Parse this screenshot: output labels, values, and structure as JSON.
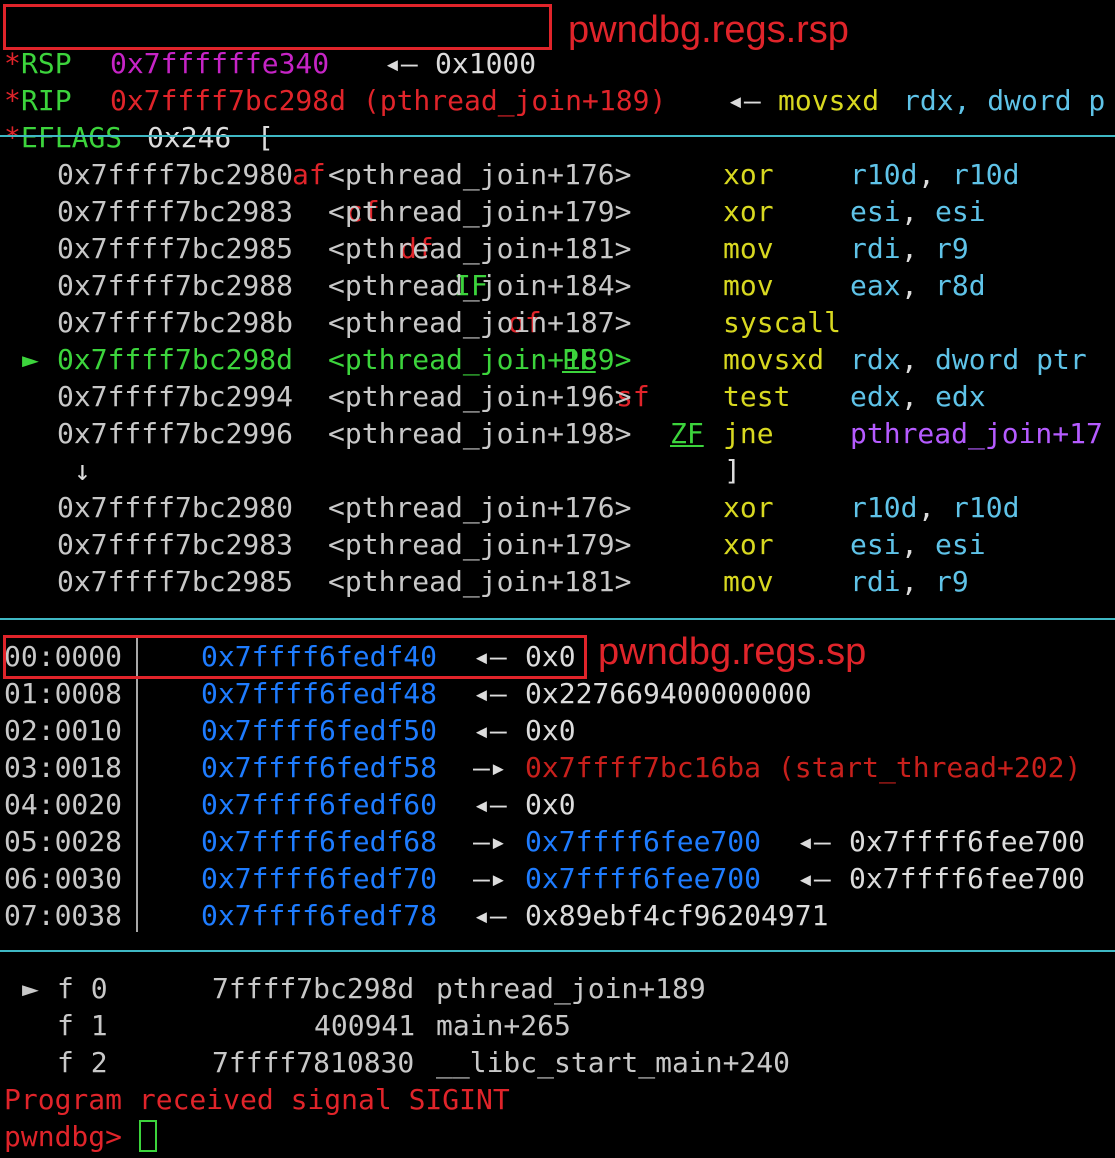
{
  "registers": {
    "rsp": {
      "star": "*",
      "name": "RSP",
      "value": "0x7ffffffe340",
      "arrow": "◂—",
      "points_to": "0x1000"
    },
    "rip": {
      "star": "*",
      "name": "RIP",
      "value": "0x7ffff7bc298d (pthread_join+189)",
      "arrow": "◂—",
      "insn": "movsxd",
      "operands": "rdx, dword p"
    },
    "eflags": {
      "star": "*",
      "name": "EFLAGS",
      "value": "0x246",
      "open": "[",
      "close": "]",
      "flags": [
        {
          "name": "af",
          "set": false
        },
        {
          "name": "cf",
          "set": false
        },
        {
          "name": "df",
          "set": false
        },
        {
          "name": "IF",
          "set": true
        },
        {
          "name": "of",
          "set": false
        },
        {
          "name": "PF",
          "set": true
        },
        {
          "name": "sf",
          "set": false
        },
        {
          "name": "ZF",
          "set": true
        }
      ]
    }
  },
  "disasm": {
    "current_marker": "►",
    "jump_arrow": "↓",
    "lines": [
      {
        "addr": "0x7ffff7bc2980",
        "sym": "<pthread_join+176>",
        "mnem": "xor",
        "op1": "r10d",
        "sep": ",",
        "op2": "r10d"
      },
      {
        "addr": "0x7ffff7bc2983",
        "sym": "<pthread_join+179>",
        "mnem": "xor",
        "op1": "esi",
        "sep": ",",
        "op2": "esi"
      },
      {
        "addr": "0x7ffff7bc2985",
        "sym": "<pthread_join+181>",
        "mnem": "mov",
        "op1": "rdi",
        "sep": ",",
        "op2": "r9"
      },
      {
        "addr": "0x7ffff7bc2988",
        "sym": "<pthread_join+184>",
        "mnem": "mov",
        "op1": "eax",
        "sep": ",",
        "op2": "r8d"
      },
      {
        "addr": "0x7ffff7bc298b",
        "sym": "<pthread_join+187>",
        "mnem": "syscall",
        "op1": "",
        "sep": "",
        "op2": ""
      },
      {
        "addr": "0x7ffff7bc298d",
        "sym": "<pthread_join+189>",
        "mnem": "movsxd",
        "op1": "rdx",
        "sep": ",",
        "op2": "dword ptr"
      },
      {
        "addr": "0x7ffff7bc2994",
        "sym": "<pthread_join+196>",
        "mnem": "test",
        "op1": "edx",
        "sep": ",",
        "op2": "edx"
      },
      {
        "addr": "0x7ffff7bc2996",
        "sym": "<pthread_join+198>",
        "mnem": "jne",
        "op1": "pthread_join+17",
        "sep": "",
        "op2": ""
      },
      {
        "addr": "0x7ffff7bc2980",
        "sym": "<pthread_join+176>",
        "mnem": "xor",
        "op1": "r10d",
        "sep": ",",
        "op2": "r10d"
      },
      {
        "addr": "0x7ffff7bc2983",
        "sym": "<pthread_join+179>",
        "mnem": "xor",
        "op1": "esi",
        "sep": ",",
        "op2": "esi"
      },
      {
        "addr": "0x7ffff7bc2985",
        "sym": "<pthread_join+181>",
        "mnem": "mov",
        "op1": "rdi",
        "sep": ",",
        "op2": "r9"
      }
    ]
  },
  "stack": [
    {
      "idx": "00:0000",
      "addr": "0x7ffff6fedf40",
      "arrow": "◂—",
      "val": "0x0",
      "val_kind": "plain",
      "arrow2": "",
      "val2": ""
    },
    {
      "idx": "01:0008",
      "addr": "0x7ffff6fedf48",
      "arrow": "◂—",
      "val": "0x227669400000000",
      "val_kind": "plain",
      "arrow2": "",
      "val2": ""
    },
    {
      "idx": "02:0010",
      "addr": "0x7ffff6fedf50",
      "arrow": "◂—",
      "val": "0x0",
      "val_kind": "plain",
      "arrow2": "",
      "val2": ""
    },
    {
      "idx": "03:0018",
      "addr": "0x7ffff6fedf58",
      "arrow": "—▸",
      "val": "0x7ffff7bc16ba (start_thread+202)",
      "val_kind": "code",
      "arrow2": "",
      "val2": ""
    },
    {
      "idx": "04:0020",
      "addr": "0x7ffff6fedf60",
      "arrow": "◂—",
      "val": "0x0",
      "val_kind": "plain",
      "arrow2": "",
      "val2": ""
    },
    {
      "idx": "05:0028",
      "addr": "0x7ffff6fedf68",
      "arrow": "—▸",
      "val": "0x7ffff6fee700",
      "val_kind": "stack",
      "arrow2": "◂—",
      "val2": "0x7ffff6fee700"
    },
    {
      "idx": "06:0030",
      "addr": "0x7ffff6fedf70",
      "arrow": "—▸",
      "val": "0x7ffff6fee700",
      "val_kind": "stack",
      "arrow2": "◂—",
      "val2": "0x7ffff6fee700"
    },
    {
      "idx": "07:0038",
      "addr": "0x7ffff6fedf78",
      "arrow": "◂—",
      "val": "0x89ebf4cf96204971",
      "val_kind": "plain",
      "arrow2": "",
      "val2": ""
    }
  ],
  "backtrace": [
    {
      "marker": "►",
      "frame": "f 0",
      "addr": "7ffff7bc298d",
      "sym": "pthread_join+189"
    },
    {
      "marker": "",
      "frame": "f 1",
      "addr": "400941",
      "sym": "main+265"
    },
    {
      "marker": "",
      "frame": "f 2",
      "addr": "7ffff7810830",
      "sym": "__libc_start_main+240"
    }
  ],
  "signal_msg": "Program received signal SIGINT",
  "prompt": "pwndbg>",
  "annotations": {
    "rsp": "pwndbg.regs.rsp",
    "sp": "pwndbg.regs.sp"
  },
  "colors": {
    "changed_star": "#e0242a",
    "stack_addr": "#1e7cff",
    "mnemonic": "#d8d820",
    "register": "#5fc3e8",
    "separator_line": "#3fb8c4",
    "current_line": "#3cd43c",
    "highlight_box": "#e0242a"
  }
}
